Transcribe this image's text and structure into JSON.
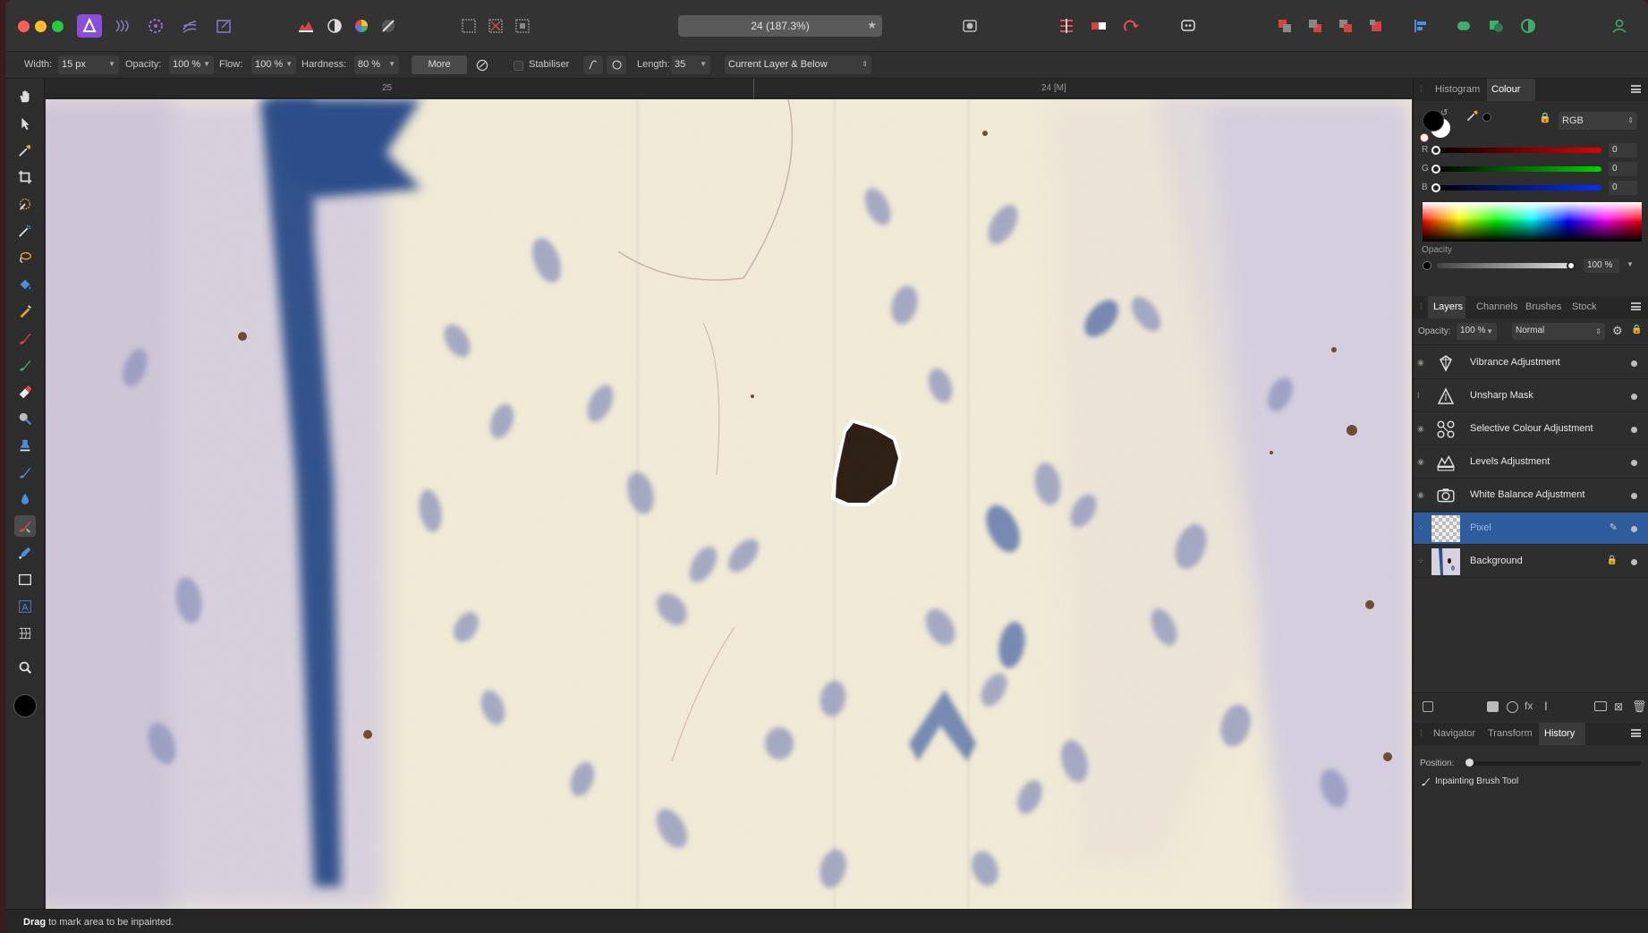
{
  "title_bar": {
    "document_title": "24 (187.3%)"
  },
  "context_toolbar": {
    "width_label": "Width:",
    "width_value": "15 px",
    "opacity_label": "Opacity:",
    "opacity_value": "100 %",
    "flow_label": "Flow:",
    "flow_value": "100 %",
    "hardness_label": "Hardness:",
    "hardness_value": "80 %",
    "more_label": "More",
    "stabiliser_label": "Stabiliser",
    "length_label": "Length:",
    "length_value": "35",
    "source_value": "Current Layer & Below"
  },
  "ruler": {
    "left_label": "25",
    "right_label": "24 [M]"
  },
  "colour_panel": {
    "tabs": [
      "Histogram",
      "Colour"
    ],
    "active_tab": "Colour",
    "model": "RGB",
    "r_label": "R",
    "r_value": "0",
    "g_label": "G",
    "g_value": "0",
    "b_label": "B",
    "b_value": "0",
    "opacity_label": "Opacity",
    "opacity_value": "100 %"
  },
  "layers_panel": {
    "tabs": [
      "Layers",
      "Channels",
      "Brushes",
      "Stock"
    ],
    "active_tab": "Layers",
    "opacity_label": "Opacity:",
    "opacity_value": "100 %",
    "blend_mode": "Normal",
    "layers": [
      {
        "name": "Vibrance Adjustment",
        "icon": "vibrance-icon"
      },
      {
        "name": "Unsharp Mask",
        "icon": "unsharp-mask-icon"
      },
      {
        "name": "Selective Colour Adjustment",
        "icon": "selective-colour-icon"
      },
      {
        "name": "Levels Adjustment",
        "icon": "levels-icon"
      },
      {
        "name": "White Balance Adjustment",
        "icon": "white-balance-icon"
      },
      {
        "name": "Pixel",
        "icon": "pixel-layer-thumbnail",
        "selected": true
      },
      {
        "name": "Background",
        "icon": "background-thumbnail",
        "locked": true
      }
    ]
  },
  "history_panel": {
    "tabs": [
      "Navigator",
      "Transform",
      "History"
    ],
    "active_tab": "History",
    "position_label": "Position:",
    "entries": [
      "Inpainting Brush Tool"
    ]
  },
  "status_bar": {
    "bold": "Drag",
    "text": " to mark area to be inpainted."
  },
  "colors": {
    "accent": "#2f5c9c",
    "persona_purple": "#8a4fd6"
  }
}
